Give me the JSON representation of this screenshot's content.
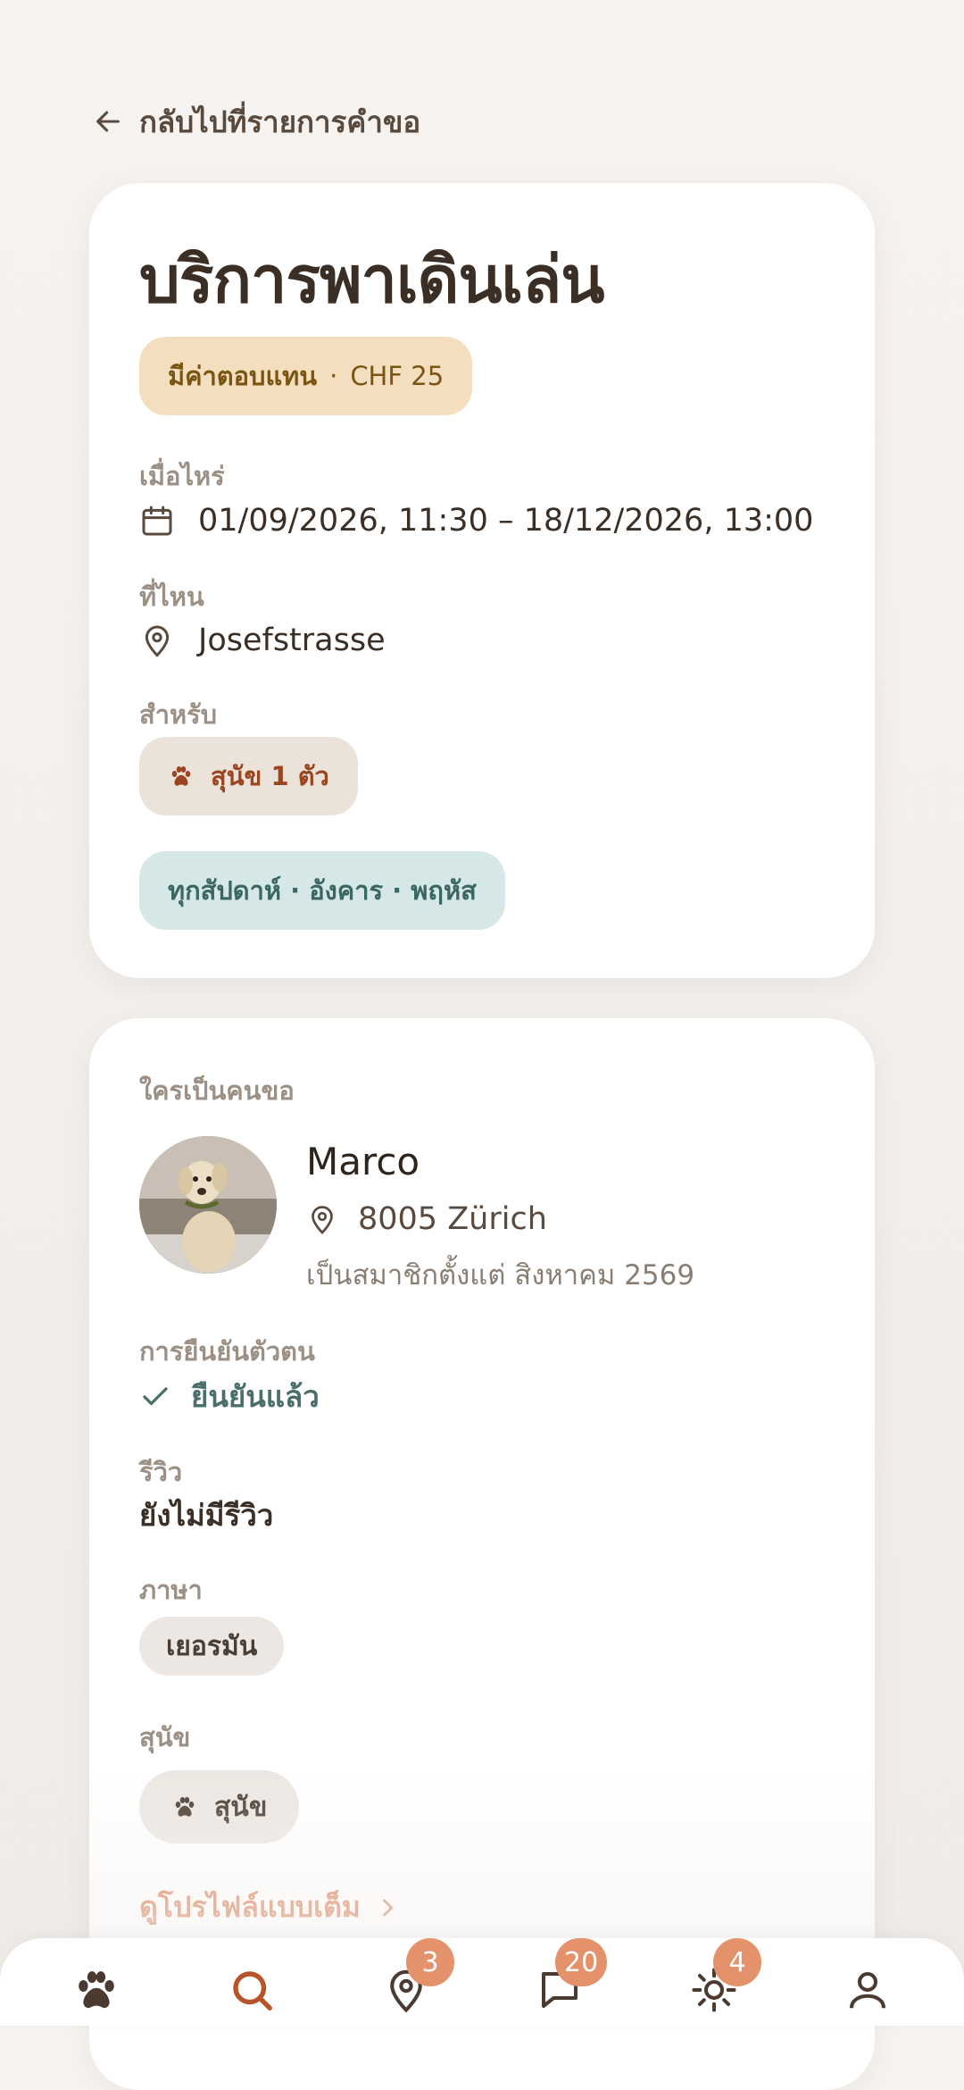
{
  "back": {
    "label": "กลับไปที่รายการคำขอ"
  },
  "request": {
    "title": "บริการพาเดินเล่น",
    "payment_label": "มีค่าตอบแทน",
    "payment_sep": "·",
    "payment_amount": "CHF 25",
    "when_label": "เมื่อไหร่",
    "when_value": "01/09/2026, 11:30 – 18/12/2026, 13:00",
    "where_label": "ที่ไหน",
    "where_value": "Josefstrasse",
    "for_label": "สำหรับ",
    "pet_value": "สุนัข 1 ตัว",
    "schedule": "ทุกสัปดาห์ · อังคาร · พฤหัส"
  },
  "requester": {
    "section_label": "ใครเป็นคนขอ",
    "name": "Marco",
    "location": "8005 Zürich",
    "member_since": "เป็นสมาชิกตั้งแต่ สิงหาคม 2569",
    "verification_label": "การยืนยันตัวตน",
    "verification_value": "ยืนยันแล้ว",
    "reviews_label": "รีวิว",
    "reviews_value": "ยังไม่มีรีวิว",
    "language_label": "ภาษา",
    "language_value": "เยอรมัน",
    "dogs_label": "สุนัข",
    "dogs_value": "สุนัข",
    "full_profile": "ดูโปรไฟล์แบบเต็ม"
  },
  "nav": {
    "items": [
      {
        "icon": "paw-icon"
      },
      {
        "icon": "search-icon"
      },
      {
        "icon": "map-pin-icon",
        "badge": "3"
      },
      {
        "icon": "chat-icon",
        "badge": "20"
      },
      {
        "icon": "sun-icon",
        "badge": "4"
      },
      {
        "icon": "profile-icon"
      }
    ]
  },
  "colors": {
    "accent": "#e4926b",
    "pay_bg": "#f3dfbf",
    "schedule_bg": "#d5e7e7",
    "pet_bg": "#ebe2da"
  }
}
